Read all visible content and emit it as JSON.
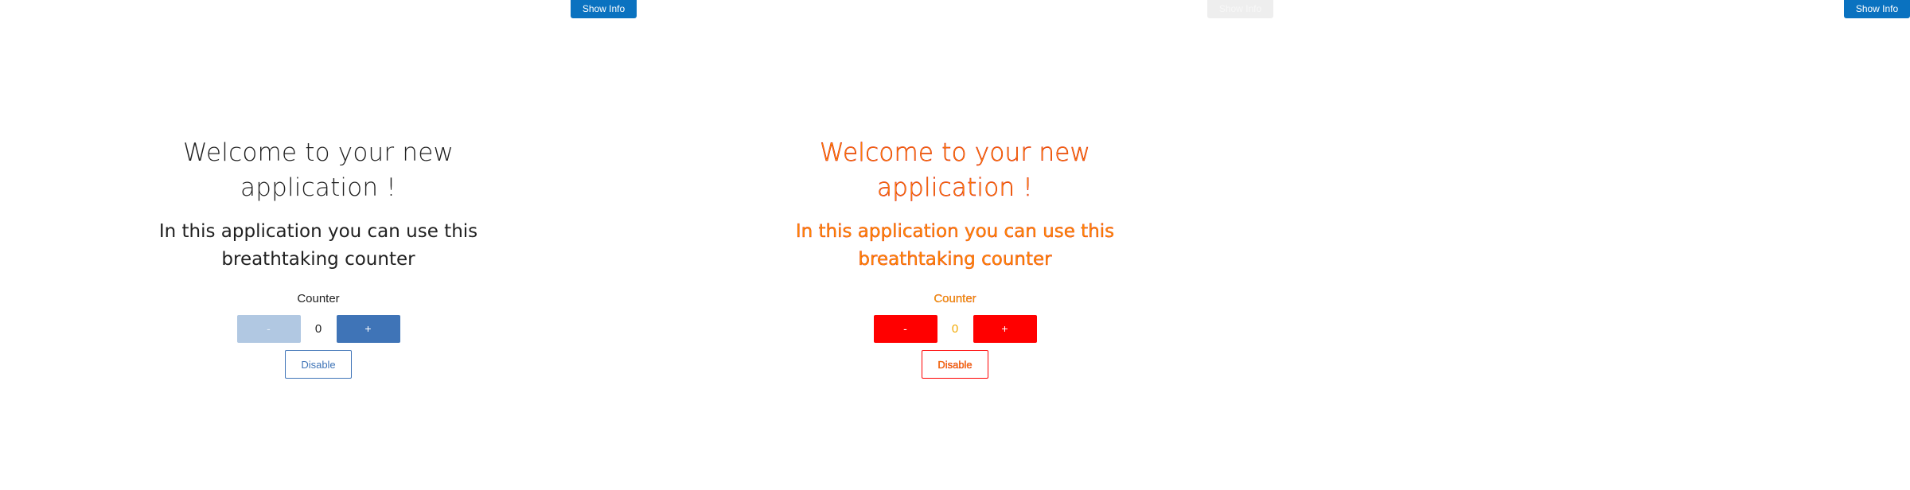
{
  "panels": [
    {
      "show_info_label": "Show Info",
      "welcome_line1": "Welcome to your new",
      "welcome_line2": "application !",
      "subtitle_line1": "In this application you can use this",
      "subtitle_line2": "breathtaking counter",
      "counter_label": "Counter",
      "minus_label": "-",
      "counter_value": "0",
      "plus_label": "+",
      "disable_label": "Disable"
    },
    {
      "show_info_label": "Show Info",
      "welcome_line1": "Welcome to your new",
      "welcome_line2": "application !",
      "subtitle_line1": "In this application you can use this",
      "subtitle_line2": "breathtaking counter",
      "counter_label": "Counter",
      "minus_label": "-",
      "counter_value": "0",
      "plus_label": "+",
      "disable_label": "Disable"
    },
    {
      "show_info_label": "Show Info"
    }
  ],
  "colors": {
    "show_info_bg": "#0a72c0",
    "primary_blue": "#3f74b7",
    "disabled_blue": "#b1c8e2",
    "alt_red": "#ff0000",
    "alt_orange": "#ff8c00"
  }
}
